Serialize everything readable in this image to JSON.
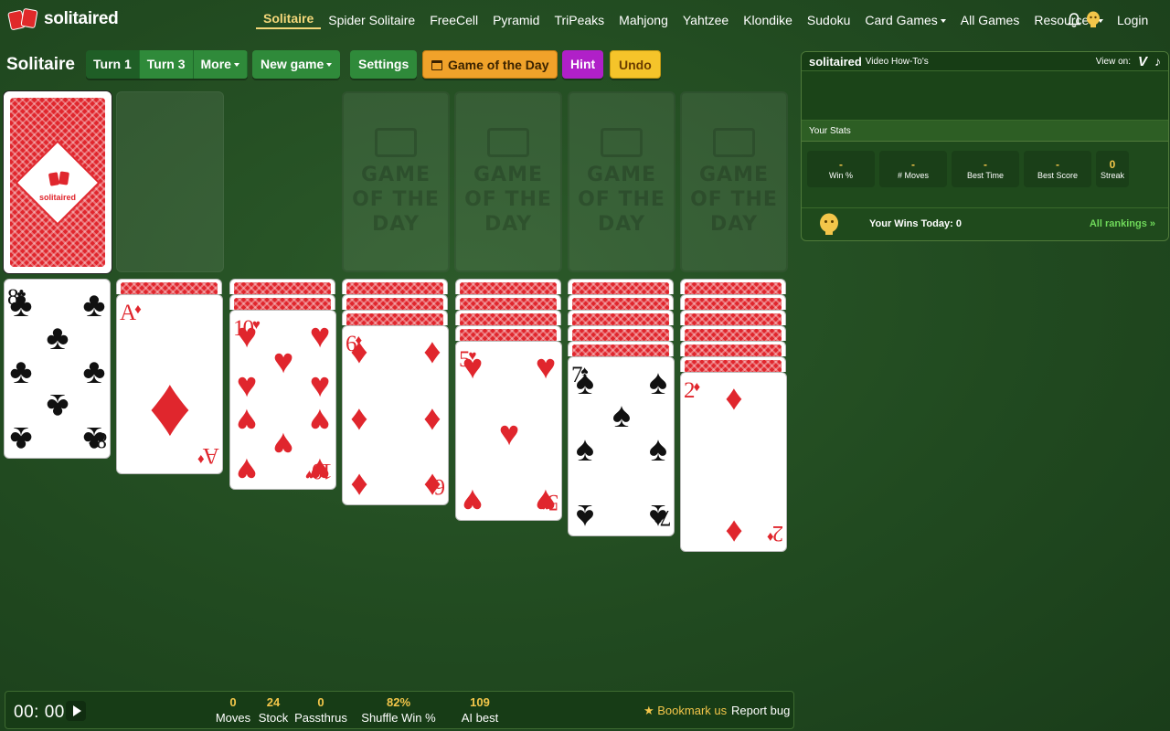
{
  "brand": {
    "name": "solitaired"
  },
  "nav": {
    "items": [
      {
        "label": "Solitaire",
        "active": true
      },
      {
        "label": "Spider Solitaire"
      },
      {
        "label": "FreeCell"
      },
      {
        "label": "Pyramid"
      },
      {
        "label": "TriPeaks"
      },
      {
        "label": "Mahjong"
      },
      {
        "label": "Yahtzee"
      },
      {
        "label": "Klondike"
      },
      {
        "label": "Sudoku"
      },
      {
        "label": "Card Games",
        "dropdown": true
      },
      {
        "label": "All Games"
      },
      {
        "label": "Resources",
        "dropdown": true
      }
    ],
    "login": "Login",
    "icons": [
      "bell-icon",
      "avatar-icon"
    ]
  },
  "toolbar": {
    "title": "Solitaire",
    "turn1": "Turn 1",
    "turn3": "Turn 3",
    "more": "More",
    "new_game": "New game",
    "settings": "Settings",
    "game_of_day": "Game of the Day",
    "hint": "Hint",
    "undo": "Undo"
  },
  "board": {
    "foundation_placeholder": [
      "GAME",
      "OF THE",
      "DAY"
    ],
    "stock_logo": "solitaired",
    "tableau": [
      {
        "rank": "8",
        "suit": "♣",
        "color": "black",
        "face_down": 0
      },
      {
        "rank": "A",
        "suit": "♦",
        "color": "red",
        "face_down": 1
      },
      {
        "rank": "10",
        "suit": "♥",
        "color": "red",
        "face_down": 2
      },
      {
        "rank": "6",
        "suit": "♦",
        "color": "red",
        "face_down": 3
      },
      {
        "rank": "5",
        "suit": "♥",
        "color": "red",
        "face_down": 4
      },
      {
        "rank": "7",
        "suit": "♠",
        "color": "black",
        "face_down": 5
      },
      {
        "rank": "2",
        "suit": "♦",
        "color": "red",
        "face_down": 6
      }
    ]
  },
  "panel": {
    "header_logo": "solitaired",
    "header_title": "Video How-To's",
    "view_on": "View on:",
    "vimeo": "V",
    "tiktok": "♪",
    "stats_title": "Your Stats",
    "stats": [
      {
        "value": "-",
        "label": "Win %"
      },
      {
        "value": "-",
        "label": "# Moves"
      },
      {
        "value": "-",
        "label": "Best Time"
      },
      {
        "value": "-",
        "label": "Best Score"
      },
      {
        "value": "0",
        "label": "Streak"
      }
    ],
    "wins_today": "Your Wins Today: 0",
    "rankings": "All rankings »"
  },
  "bottom": {
    "timer": "00: 00",
    "metrics": [
      {
        "value": "0",
        "label": "Moves"
      },
      {
        "value": "24",
        "label": "Stock"
      },
      {
        "value": "0",
        "label": "Passthrus"
      },
      {
        "value": "82%",
        "label": "Shuffle Win %"
      },
      {
        "value": "109",
        "label": "AI best moves"
      }
    ],
    "bookmark": "★ Bookmark us",
    "report_bug": "Report bug"
  },
  "colors": {
    "felt": "#214a20",
    "accent": "#f3c64a",
    "card_red": "#e0262d"
  }
}
